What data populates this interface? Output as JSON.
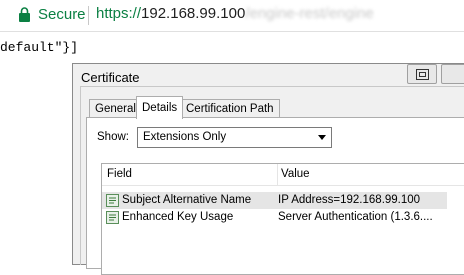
{
  "browser": {
    "secure_label": "Secure",
    "url_scheme": "https://",
    "url_host": "192.168.99.100",
    "url_path": "/engine-rest/engine"
  },
  "page": {
    "code_text": "default\"}]"
  },
  "dialog": {
    "title": "Certificate",
    "tabs": [
      {
        "label": "General"
      },
      {
        "label": "Details"
      },
      {
        "label": "Certification Path"
      }
    ],
    "show_label": "Show:",
    "show_value": "Extensions Only",
    "table": {
      "headers": {
        "field": "Field",
        "value": "Value"
      },
      "rows": [
        {
          "field": "Subject Alternative Name",
          "value": "IP Address=192.168.99.100",
          "icon": "extension-icon"
        },
        {
          "field": "Enhanced Key Usage",
          "value": "Server Authentication (1.3.6....",
          "icon": "extension-icon"
        }
      ]
    }
  }
}
